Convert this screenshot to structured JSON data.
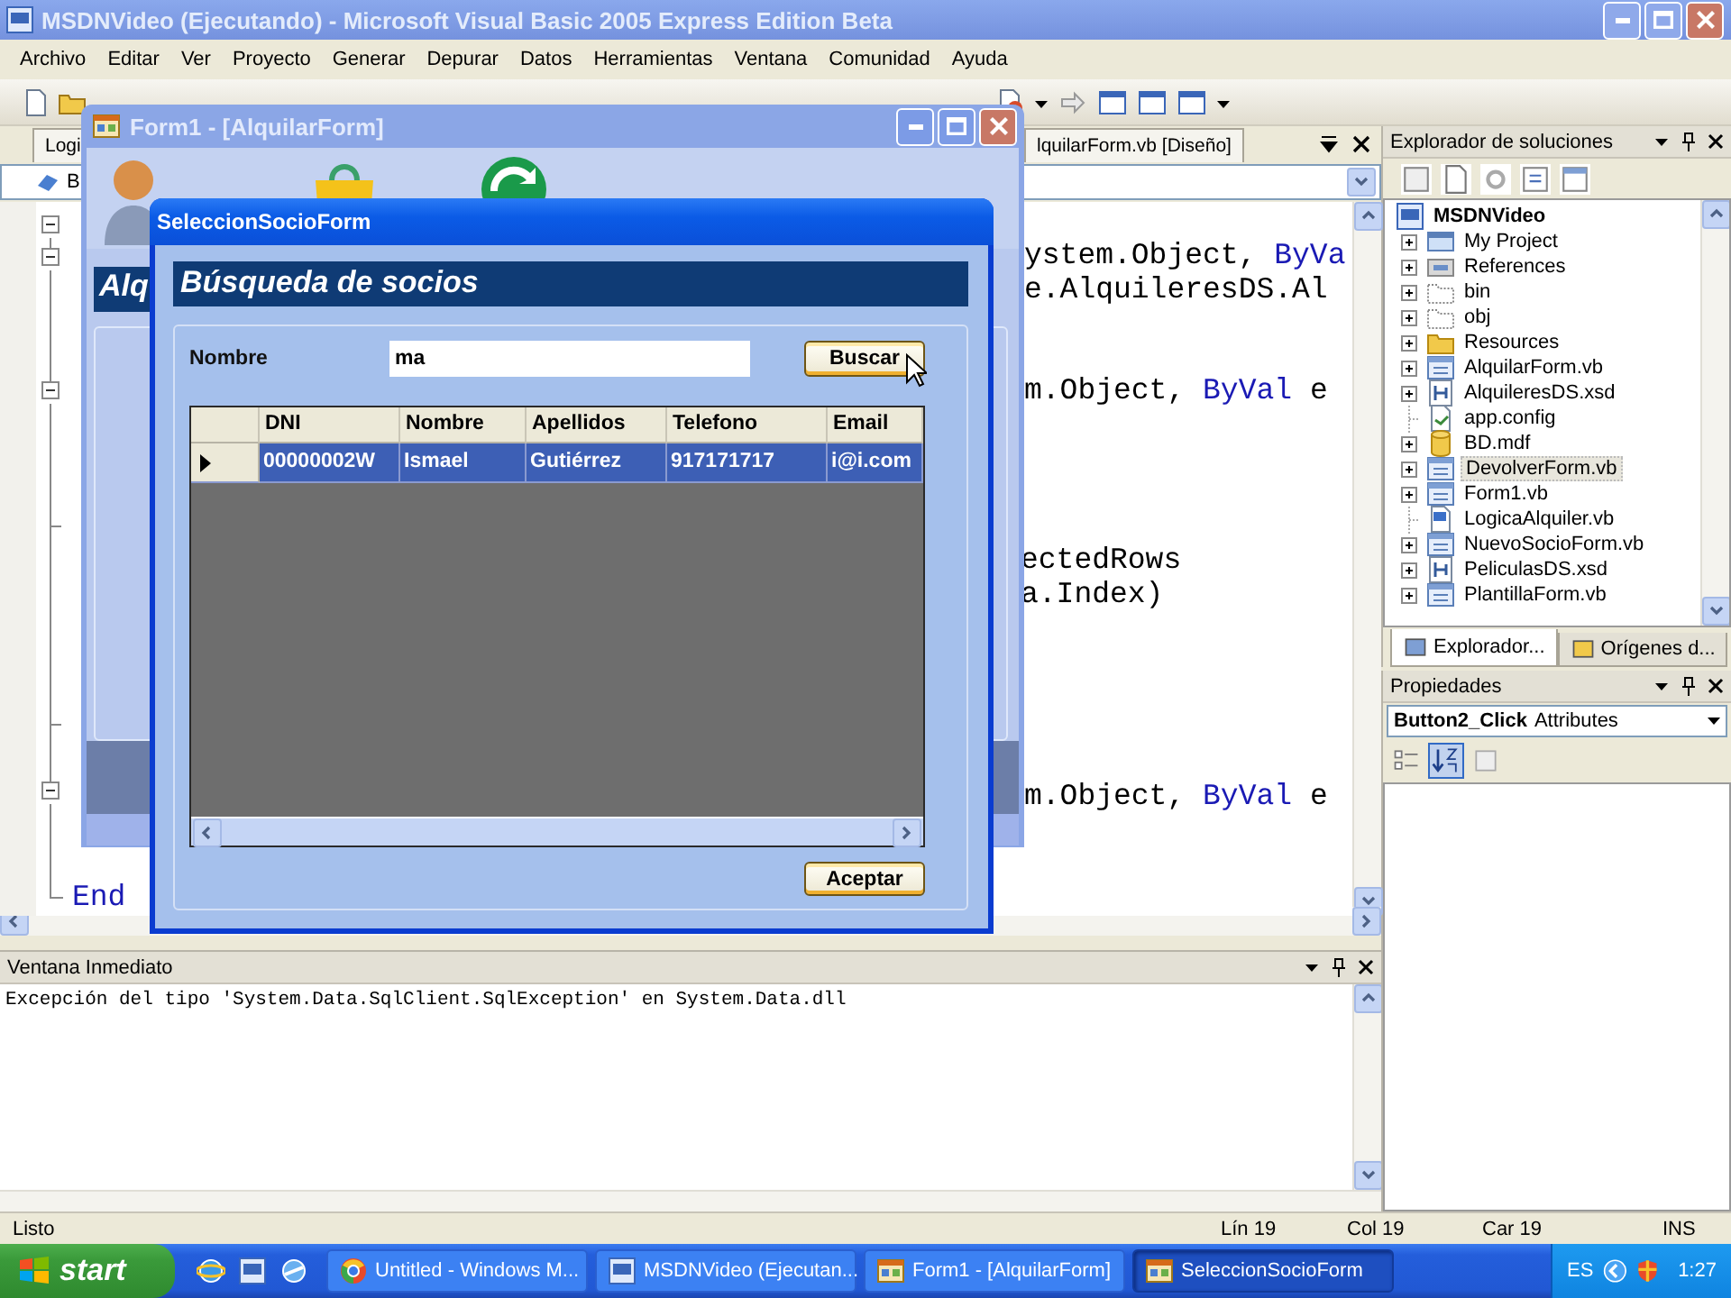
{
  "window": {
    "title": "MSDNVideo (Ejecutando) - Microsoft Visual Basic 2005 Express Edition Beta"
  },
  "menu": [
    "Archivo",
    "Editar",
    "Ver",
    "Proyecto",
    "Generar",
    "Depurar",
    "Datos",
    "Herramientas",
    "Ventana",
    "Comunidad",
    "Ayuda"
  ],
  "document_tabs": [
    "Logi",
    "lquilarForm.vb [Diseño]"
  ],
  "member_dropdown": {
    "value": "B"
  },
  "code_lines": [
    {
      "segments": [
        {
          "text": "ystem.Object, ",
          "kind": "plain"
        },
        {
          "text": "ByVa",
          "kind": "keyword"
        }
      ]
    },
    {
      "segments": [
        {
          "text": "e.AlquileresDS.Al",
          "kind": "plain"
        }
      ]
    },
    {
      "segments": [
        {
          "text": "m.Object, ",
          "kind": "plain"
        },
        {
          "text": "ByVal",
          "kind": "keyword"
        },
        {
          "text": " e",
          "kind": "plain"
        }
      ]
    },
    {
      "segments": [
        {
          "text": "ectedRows",
          "kind": "plain"
        }
      ]
    },
    {
      "segments": [
        {
          "text": "a.Index)",
          "kind": "plain"
        }
      ]
    },
    {
      "segments": [
        {
          "text": "m.Object, ",
          "kind": "plain"
        },
        {
          "text": "ByVal",
          "kind": "keyword"
        },
        {
          "text": " e",
          "kind": "plain"
        }
      ]
    },
    {
      "segments": [
        {
          "text": "End",
          "kind": "keyword"
        }
      ]
    }
  ],
  "form1": {
    "title": "Form1 - [AlquilarForm]",
    "heading": "Alq"
  },
  "dialog": {
    "title": "SeleccionSocioForm",
    "heading": "Búsqueda de socios",
    "search_label": "Nombre",
    "search_value": "ma",
    "search_button": "Buscar",
    "grid": {
      "columns": [
        "DNI",
        "Nombre",
        "Apellidos",
        "Telefono",
        "Email"
      ],
      "rows": [
        {
          "cells": [
            "00000002W",
            "Ismael",
            "Gutiérrez",
            "917171717",
            "i@i.com"
          ],
          "selected": true
        }
      ]
    },
    "accept_button": "Aceptar"
  },
  "immediate": {
    "title": "Ventana Inmediato",
    "lines": [
      "Excepción del tipo 'System.Data.SqlClient.SqlException' en System.Data.dll"
    ]
  },
  "solution_explorer": {
    "title": "Explorador de soluciones",
    "root": "MSDNVideo",
    "items": [
      {
        "label": "My Project",
        "kind": "project",
        "expandable": true,
        "selected": false
      },
      {
        "label": "References",
        "kind": "references",
        "expandable": true,
        "selected": false
      },
      {
        "label": "bin",
        "kind": "folder",
        "expandable": true,
        "selected": false
      },
      {
        "label": "obj",
        "kind": "folder",
        "expandable": true,
        "selected": false
      },
      {
        "label": "Resources",
        "kind": "resources",
        "expandable": true,
        "selected": false
      },
      {
        "label": "AlquilarForm.vb",
        "kind": "form",
        "expandable": true,
        "selected": false
      },
      {
        "label": "AlquileresDS.xsd",
        "kind": "dataset",
        "expandable": true,
        "selected": false
      },
      {
        "label": "app.config",
        "kind": "config",
        "expandable": false,
        "selected": false
      },
      {
        "label": "BD.mdf",
        "kind": "database",
        "expandable": true,
        "selected": false
      },
      {
        "label": "DevolverForm.vb",
        "kind": "form",
        "expandable": true,
        "selected": true
      },
      {
        "label": "Form1.vb",
        "kind": "form",
        "expandable": true,
        "selected": false
      },
      {
        "label": "LogicaAlquiler.vb",
        "kind": "module",
        "expandable": false,
        "selected": false
      },
      {
        "label": "NuevoSocioForm.vb",
        "kind": "form",
        "expandable": true,
        "selected": false
      },
      {
        "label": "PeliculasDS.xsd",
        "kind": "dataset",
        "expandable": true,
        "selected": false
      },
      {
        "label": "PlantillaForm.vb",
        "kind": "form",
        "expandable": true,
        "selected": false
      }
    ],
    "tabs": [
      {
        "label": "Explorador...",
        "selected": true
      },
      {
        "label": "Orígenes d...",
        "selected": false
      }
    ]
  },
  "properties": {
    "title": "Propiedades",
    "object": "Button2_Click",
    "object_type": "Attributes"
  },
  "status_bar": {
    "message": "Listo",
    "line": "Lín 19",
    "column": "Col 19",
    "char": "Car 19",
    "mode": "INS"
  },
  "taskbar": {
    "start": "start",
    "tasks": [
      {
        "label": "Untitled - Windows M...",
        "kind": "browser",
        "selected": false
      },
      {
        "label": "MSDNVideo (Ejecutan...",
        "kind": "vb",
        "selected": false
      },
      {
        "label": "Form1 - [AlquilarForm]",
        "kind": "form",
        "selected": false
      },
      {
        "label": "SeleccionSocioForm",
        "kind": "form",
        "selected": true
      }
    ],
    "language": "ES",
    "clock": "1:27"
  }
}
